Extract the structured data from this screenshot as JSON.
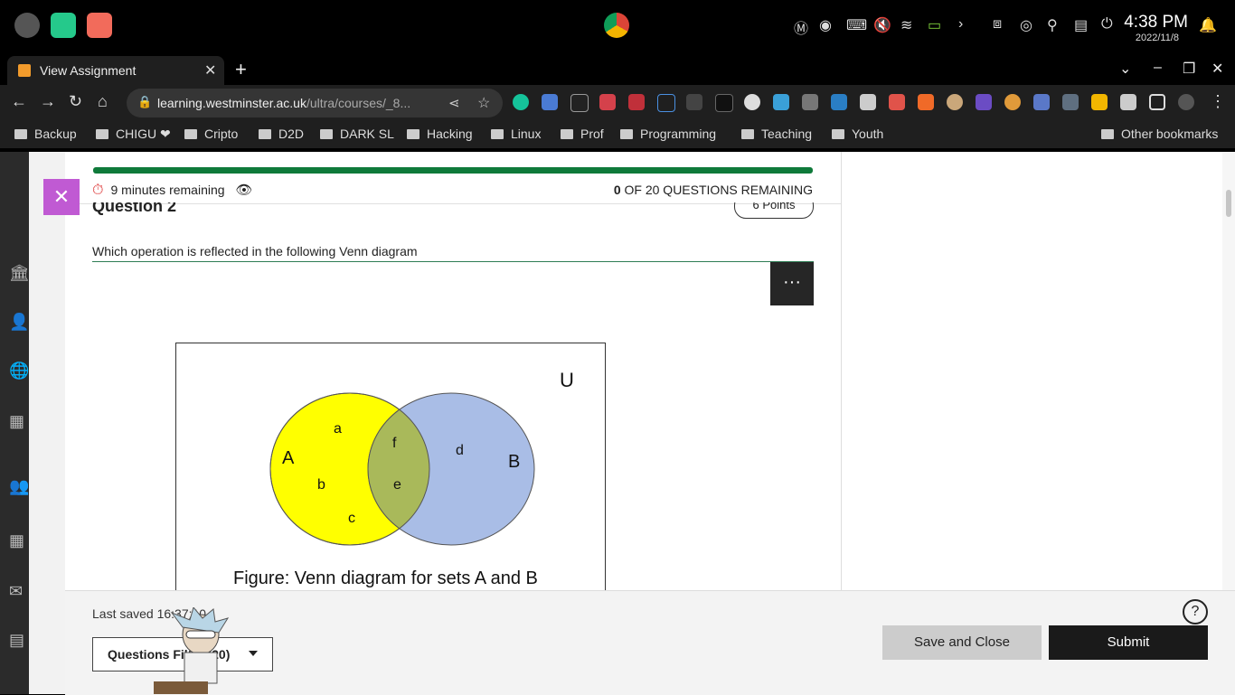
{
  "os": {
    "time": "4:38 PM",
    "date": "2022/11/8"
  },
  "browser": {
    "tab_title": "View Assignment",
    "url_host": "learning.westminster.ac.uk",
    "url_path": "/ultra/courses/_8...",
    "bookmarks": [
      "Backup",
      "CHIGU ❤",
      "Cripto",
      "D2D",
      "DARK SL",
      "Hacking",
      "Linux",
      "Prof",
      "Programming",
      "Teaching",
      "Youth"
    ],
    "other_bookmarks": "Other bookmarks"
  },
  "assessment": {
    "progress_fraction": 1.0,
    "timer_text": "9 minutes remaining",
    "remaining_count": "0",
    "remaining_text": "OF 20 QUESTIONS REMAINING",
    "question_heading": "Question 2",
    "points": "6 Points",
    "question_text": "Which operation is reflected in the following Venn diagram",
    "more_label": "···"
  },
  "venn": {
    "universe_label": "U",
    "set_a_label": "A",
    "set_b_label": "B",
    "a_only": [
      "a",
      "b",
      "c"
    ],
    "intersection": [
      "f",
      "e"
    ],
    "b_only": [
      "d"
    ],
    "caption": "Figure: Venn diagram for sets A and B",
    "colors": {
      "a": "#ffff00",
      "b": "#a9bde6",
      "overlap": "#a9b95a"
    }
  },
  "footer": {
    "last_saved": "Last saved 16:37:10",
    "filter_label": "Questions Filter (20)",
    "save_close": "Save and Close",
    "submit": "Submit",
    "help": "?"
  }
}
